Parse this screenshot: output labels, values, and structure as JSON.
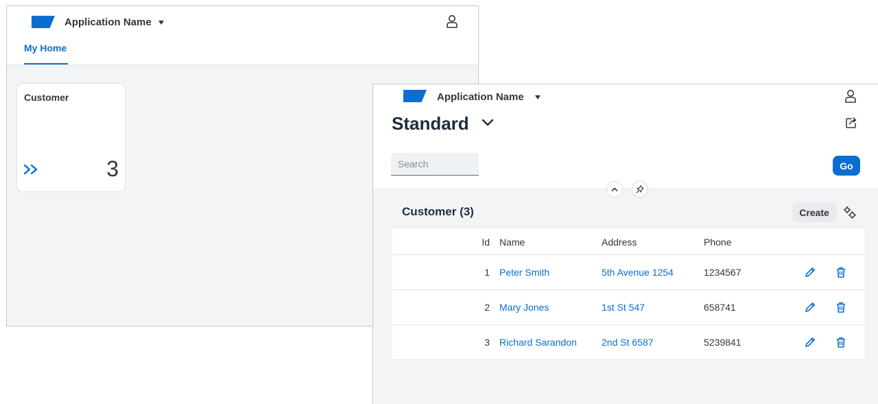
{
  "launchpad": {
    "app_name": "Application Name",
    "tab": "My Home",
    "tile": {
      "title": "Customer",
      "count": "3"
    }
  },
  "list_report": {
    "app_name": "Application Name",
    "variant": "Standard",
    "search": {
      "placeholder": "Search",
      "value": ""
    },
    "go_label": "Go",
    "table": {
      "title": "Customer (3)",
      "create_label": "Create",
      "columns": [
        "Id",
        "Name",
        "Address",
        "Phone"
      ],
      "rows": [
        {
          "id": "1",
          "name": "Peter Smith",
          "address": "5th Avenue 1254",
          "phone": "1234567"
        },
        {
          "id": "2",
          "name": "Mary Jones",
          "address": "1st St 547",
          "phone": "658741"
        },
        {
          "id": "3",
          "name": "Richard Sarandon",
          "address": "2nd St 6587",
          "phone": "5239841"
        }
      ]
    }
  },
  "colors": {
    "accent": "#0a6ed1",
    "text": "#32363a",
    "background": "#f3f4f6"
  },
  "icons": [
    "brand-logo",
    "chevron-down-icon",
    "user-icon",
    "double-chevron-right-icon",
    "share-icon",
    "collapse-up-icon",
    "pin-icon",
    "settings-icon",
    "edit-icon",
    "delete-icon"
  ]
}
